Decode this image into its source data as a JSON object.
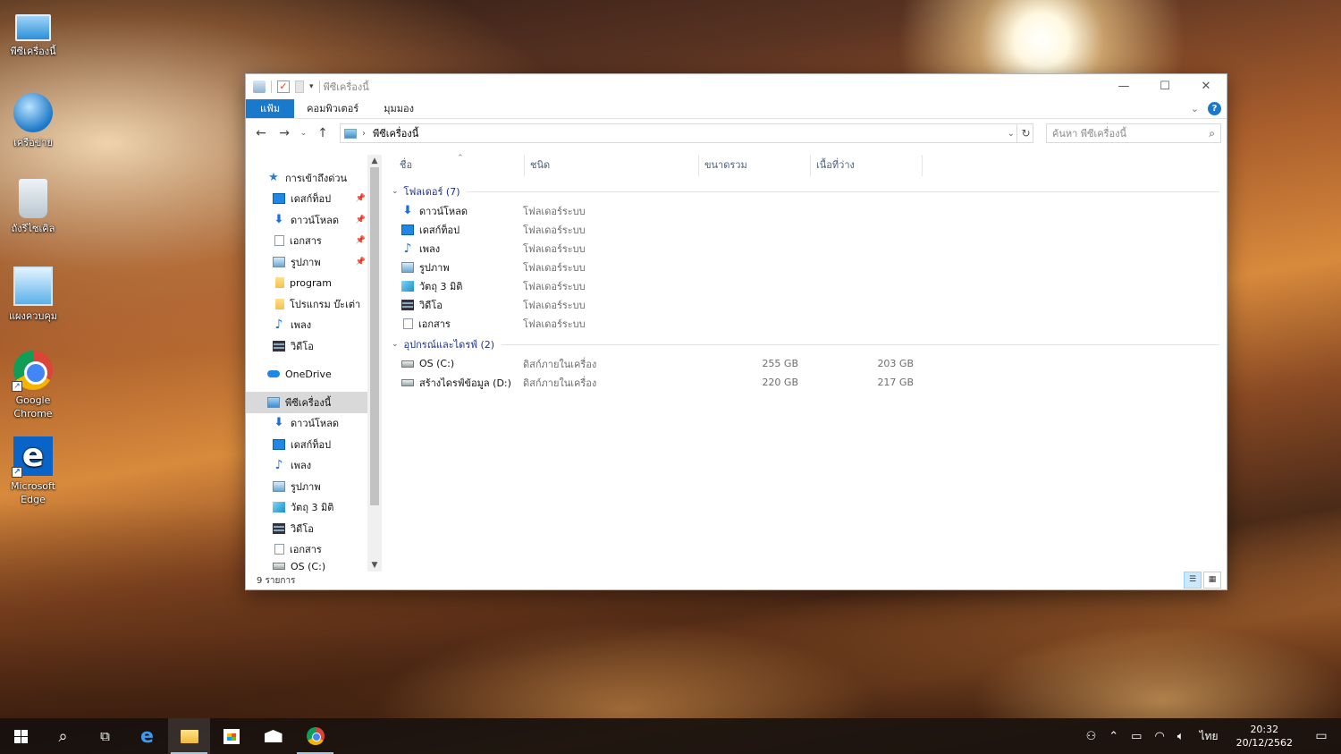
{
  "desktop": {
    "icons": [
      {
        "label": "พีซีเครื่องนี้",
        "icon": "this-pc-icon"
      },
      {
        "label": "เครือข่าย",
        "icon": "network-icon"
      },
      {
        "label": "ถังรีไซเคิล",
        "icon": "recycle-bin-icon"
      },
      {
        "label": "แผงควบคุม",
        "icon": "control-panel-icon"
      },
      {
        "label": "Google Chrome",
        "icon": "chrome-icon"
      },
      {
        "label": "Microsoft Edge",
        "icon": "edge-icon"
      }
    ]
  },
  "window": {
    "title": "พีซีเครื่องนี้",
    "controls": {
      "minimize": "—",
      "maximize": "☐",
      "close": "✕"
    },
    "ribbon_tabs": [
      "แฟ้ม",
      "คอมพิวเตอร์",
      "มุมมอง"
    ],
    "address": {
      "path": "พีซีเครื่องนี้"
    },
    "search": {
      "placeholder": "ค้นหา พีซีเครื่องนี้"
    },
    "nav": {
      "quick_access": "การเข้าถึงด่วน",
      "quick_items": [
        "เดสก์ท็อป",
        "ดาวน์โหลด",
        "เอกสาร",
        "รูปภาพ",
        "program",
        "โปรแกรม บ๊ะเต่า",
        "เพลง",
        "วิดีโอ"
      ],
      "onedrive": "OneDrive",
      "this_pc": "พีซีเครื่องนี้",
      "pc_items": [
        "ดาวน์โหลด",
        "เดสก์ท็อป",
        "เพลง",
        "รูปภาพ",
        "วัตถุ 3 มิติ",
        "วิดีโอ",
        "เอกสาร",
        "OS (C:)"
      ]
    },
    "columns": {
      "name": "ชื่อ",
      "type": "ชนิด",
      "total_size": "ขนาดรวม",
      "free_space": "เนื้อที่ว่าง"
    },
    "folders_group": "โฟลเดอร์ (7)",
    "folders": [
      {
        "name": "ดาวน์โหลด",
        "type": "โฟลเดอร์ระบบ"
      },
      {
        "name": "เดสก์ท็อป",
        "type": "โฟลเดอร์ระบบ"
      },
      {
        "name": "เพลง",
        "type": "โฟลเดอร์ระบบ"
      },
      {
        "name": "รูปภาพ",
        "type": "โฟลเดอร์ระบบ"
      },
      {
        "name": "วัตถุ 3 มิติ",
        "type": "โฟลเดอร์ระบบ"
      },
      {
        "name": "วิดีโอ",
        "type": "โฟลเดอร์ระบบ"
      },
      {
        "name": "เอกสาร",
        "type": "โฟลเดอร์ระบบ"
      }
    ],
    "drives_group": "อุปกรณ์และไดรฟ์ (2)",
    "drives": [
      {
        "name": "OS (C:)",
        "type": "ดิสก์ภายในเครื่อง",
        "total": "255 GB",
        "free": "203 GB"
      },
      {
        "name": "สร้างไดรฟ์ข้อมูล (D:)",
        "type": "ดิสก์ภายในเครื่อง",
        "total": "220 GB",
        "free": "217 GB"
      }
    ],
    "status": "9 รายการ"
  },
  "taskbar": {
    "language": "ไทย",
    "time": "20:32",
    "date": "20/12/2562"
  }
}
